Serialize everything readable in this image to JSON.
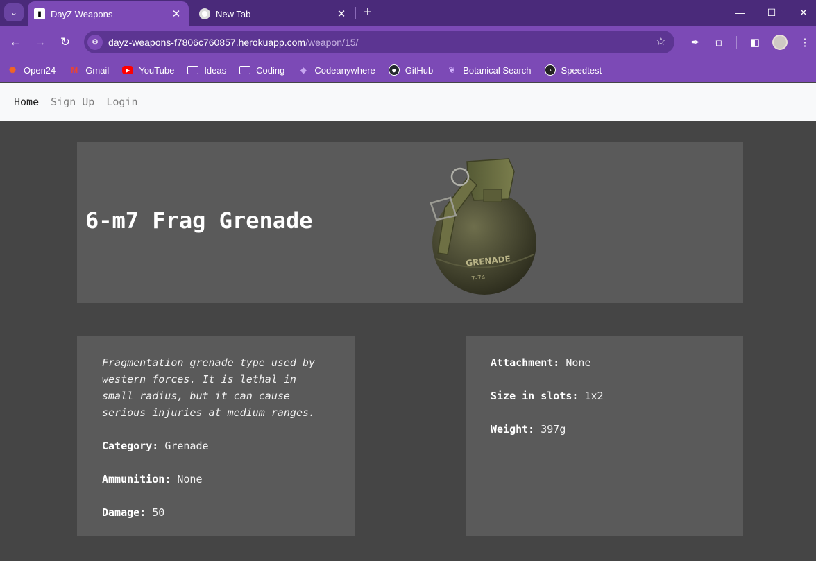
{
  "browser": {
    "tabs": [
      {
        "title": "DayZ Weapons",
        "active": true
      },
      {
        "title": "New Tab",
        "active": false
      }
    ],
    "url_host": "dayz-weapons-f7806c760857.herokuapp.com",
    "url_path": "/weapon/15/",
    "bookmarks": [
      {
        "label": "Open24",
        "icon": "open24-icon"
      },
      {
        "label": "Gmail",
        "icon": "gmail-icon"
      },
      {
        "label": "YouTube",
        "icon": "youtube-icon"
      },
      {
        "label": "Ideas",
        "icon": "folder-icon"
      },
      {
        "label": "Coding",
        "icon": "folder-icon"
      },
      {
        "label": "Codeanywhere",
        "icon": "codeanywhere-icon"
      },
      {
        "label": "GitHub",
        "icon": "github-icon"
      },
      {
        "label": "Botanical Search",
        "icon": "botanical-icon"
      },
      {
        "label": "Speedtest",
        "icon": "speedtest-icon"
      }
    ],
    "colors": {
      "tabbar": "#4a2a7a",
      "toolbar": "#7c4ab6",
      "omnibox": "#5c3592"
    }
  },
  "site_nav": {
    "home": "Home",
    "signup": "Sign Up",
    "login": "Login"
  },
  "weapon": {
    "name": "6-m7 Frag Grenade",
    "image": "grenade-image",
    "description": "Fragmentation grenade type used by western forces. It is lethal in small radius, but it can cause serious injuries at medium ranges.",
    "category_label": "Category:",
    "category": "Grenade",
    "ammunition_label": "Ammunition:",
    "ammunition": "None",
    "damage_label": "Damage:",
    "damage": "50",
    "attachment_label": "Attachment:",
    "attachment": "None",
    "size_label": "Size in slots:",
    "size": "1x2",
    "weight_label": "Weight:",
    "weight": "397g"
  },
  "page_colors": {
    "background": "#454545",
    "card": "#5a5a5a",
    "nav": "#f8f9fa"
  }
}
